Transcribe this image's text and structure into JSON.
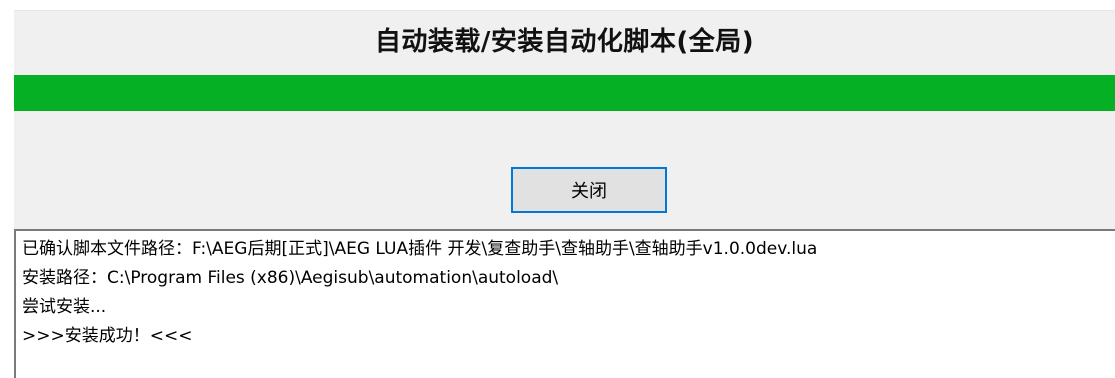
{
  "dialog": {
    "title": "自动装载/安装自动化脚本(全局)",
    "progress": 1.0,
    "progress_color": "#06b025",
    "close_label": "关闭"
  },
  "log": {
    "lines": [
      "已确认脚本文件路径：F:\\AEG后期[正式]\\AEG LUA插件 开发\\复查助手\\查轴助手\\查轴助手v1.0.0dev.lua",
      "安装路径：C:\\Program Files (x86)\\Aegisub\\automation\\autoload\\",
      "尝试安装...",
      ">>>安装成功！<<<"
    ]
  }
}
